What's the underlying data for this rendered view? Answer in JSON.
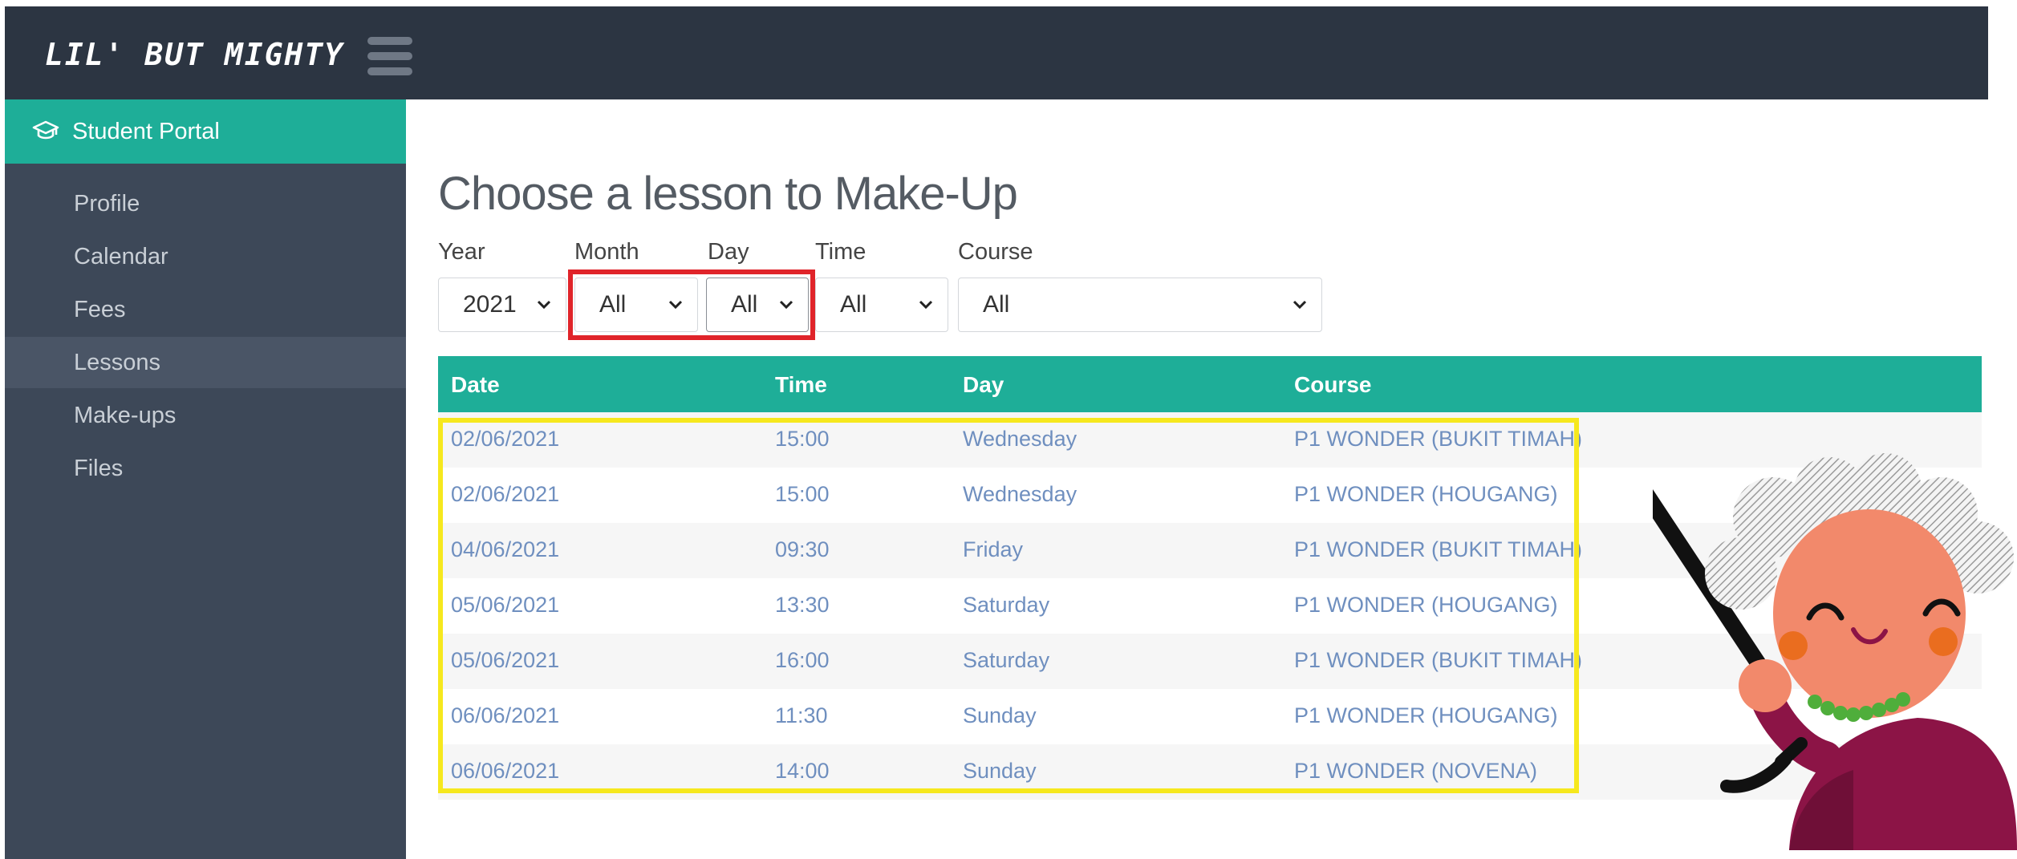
{
  "header": {
    "logo_text": "LIL' BUT MIGHTY",
    "menu_icon": "hamburger-icon"
  },
  "sidebar": {
    "section_label": "Student Portal",
    "section_icon": "graduation-cap-icon",
    "items": [
      {
        "label": "Profile"
      },
      {
        "label": "Calendar"
      },
      {
        "label": "Fees"
      },
      {
        "label": "Lessons"
      },
      {
        "label": "Make-ups"
      },
      {
        "label": "Files"
      }
    ],
    "active_item": "Lessons"
  },
  "main": {
    "title": "Choose a lesson to Make-Up",
    "filters": {
      "year": {
        "label": "Year",
        "value": "2021"
      },
      "month": {
        "label": "Month",
        "value": "All"
      },
      "day": {
        "label": "Day",
        "value": "All"
      },
      "time": {
        "label": "Time",
        "value": "All"
      },
      "course": {
        "label": "Course",
        "value": "All"
      }
    },
    "table": {
      "headers": {
        "date": "Date",
        "time": "Time",
        "day": "Day",
        "course": "Course"
      },
      "rows": [
        {
          "date": "02/06/2021",
          "time": "15:00",
          "day": "Wednesday",
          "course": "P1 WONDER (BUKIT TIMAH)"
        },
        {
          "date": "02/06/2021",
          "time": "15:00",
          "day": "Wednesday",
          "course": "P1 WONDER (HOUGANG)"
        },
        {
          "date": "04/06/2021",
          "time": "09:30",
          "day": "Friday",
          "course": "P1 WONDER (BUKIT TIMAH)"
        },
        {
          "date": "05/06/2021",
          "time": "13:30",
          "day": "Saturday",
          "course": "P1 WONDER (HOUGANG)"
        },
        {
          "date": "05/06/2021",
          "time": "16:00",
          "day": "Saturday",
          "course": "P1 WONDER (BUKIT TIMAH)"
        },
        {
          "date": "06/06/2021",
          "time": "11:30",
          "day": "Sunday",
          "course": "P1 WONDER (HOUGANG)"
        },
        {
          "date": "06/06/2021",
          "time": "14:00",
          "day": "Sunday",
          "course": "P1 WONDER (NOVENA)"
        }
      ]
    }
  },
  "colors": {
    "accent": "#1eae98",
    "topbar": "#2c3542",
    "sidebar": "#3d4858",
    "link": "#6f8fbf",
    "highlight_red": "#e0242a",
    "highlight_yellow": "#f6e81e"
  }
}
